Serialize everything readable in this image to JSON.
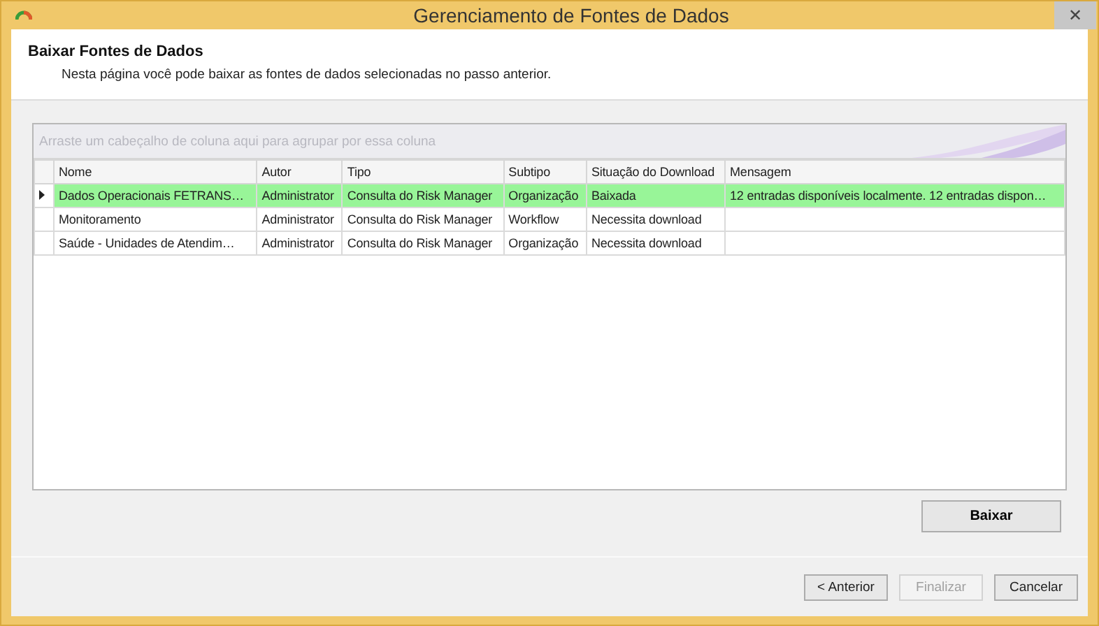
{
  "window": {
    "title": "Gerenciamento de Fontes de Dados",
    "close": "✕"
  },
  "header": {
    "title": "Baixar Fontes de Dados",
    "description": "Nesta página você pode baixar as fontes de dados selecionadas no passo anterior."
  },
  "grid": {
    "group_panel": {
      "placeholder": "Arraste um cabeçalho de coluna aqui para agrupar por essa coluna"
    },
    "columns": [
      "Nome",
      "Autor",
      "Tipo",
      "Subtipo",
      "Situação do Download",
      "Mensagem"
    ],
    "rows": [
      {
        "selected": true,
        "cells": [
          "Dados Operacionais FETRANS…",
          "Administrator",
          "Consulta do Risk Manager",
          "Organização",
          "Baixada",
          "12 entradas disponíveis localmente.  12 entradas dispon…"
        ]
      },
      {
        "selected": false,
        "cells": [
          "Monitoramento",
          "Administrator",
          "Consulta do Risk Manager",
          "Workflow",
          "Necessita download",
          ""
        ]
      },
      {
        "selected": false,
        "cells": [
          "Saúde - Unidades de Atendim…",
          "Administrator",
          "Consulta do Risk Manager",
          "Organização",
          "Necessita download",
          ""
        ]
      }
    ]
  },
  "action_button": {
    "label": "Baixar"
  },
  "buttons": [
    {
      "label": "< Anterior",
      "disabled": false
    },
    {
      "label": "Finalizar",
      "disabled": true
    },
    {
      "label": "Cancelar",
      "disabled": false
    }
  ]
}
